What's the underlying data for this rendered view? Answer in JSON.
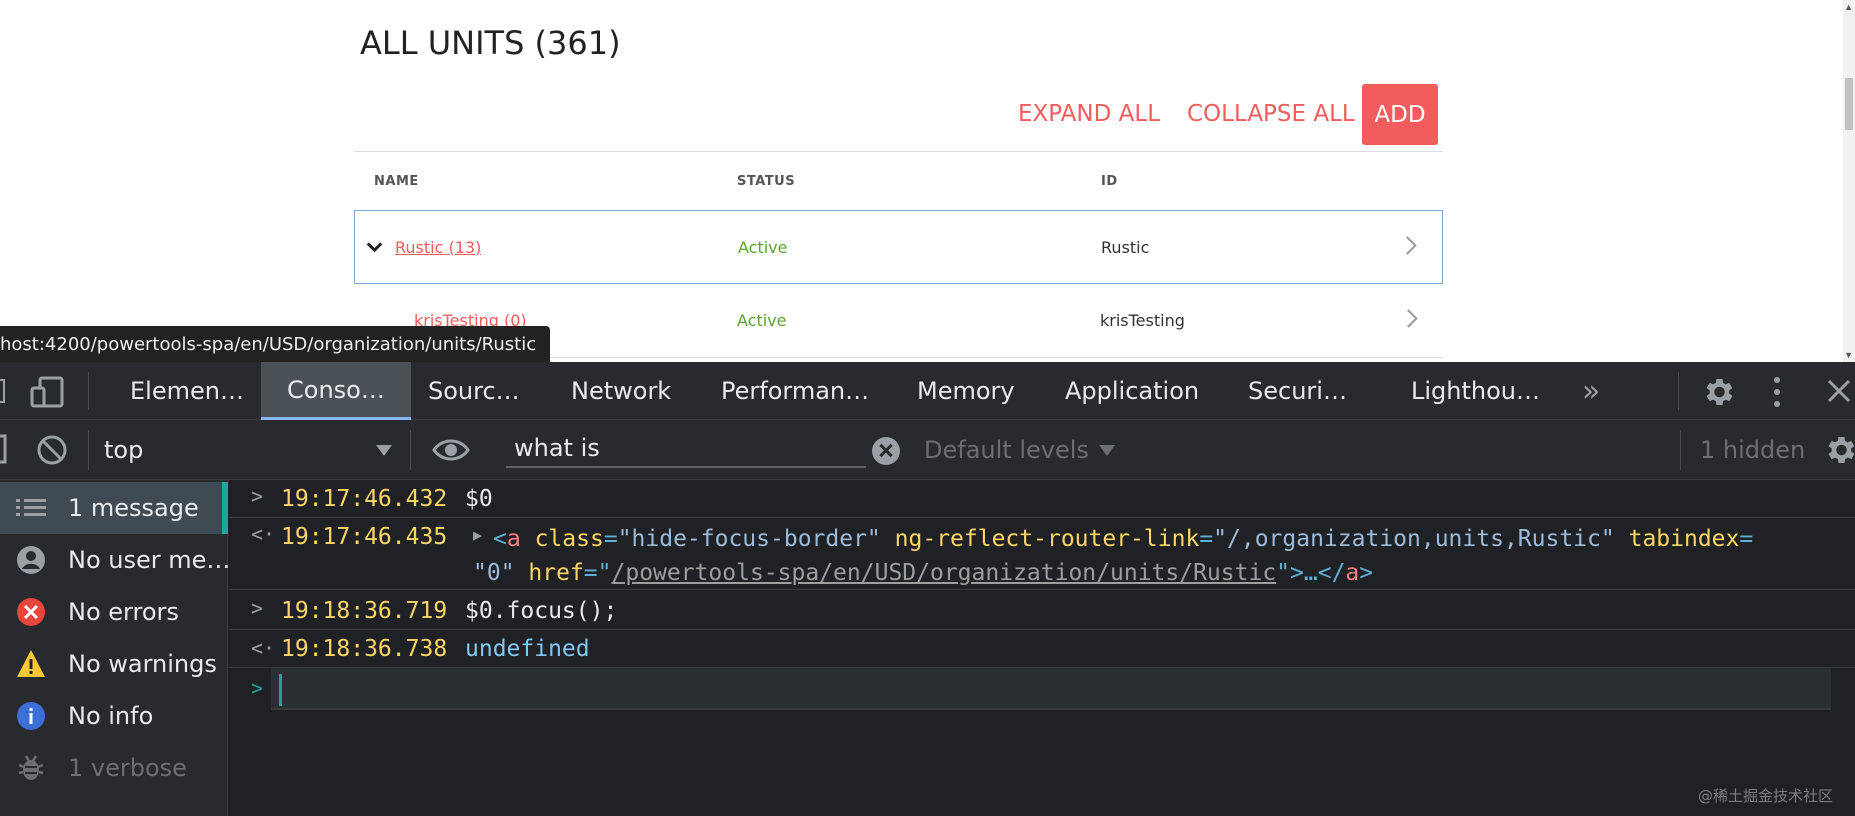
{
  "page": {
    "title": "ALL UNITS (361)",
    "actions": {
      "expand_all": "EXPAND ALL",
      "collapse_all": "COLLAPSE ALL",
      "add": "ADD"
    },
    "columns": [
      "NAME",
      "STATUS",
      "ID"
    ],
    "rows": [
      {
        "name": "Rustic (13)",
        "status": "Active",
        "id": "Rustic"
      },
      {
        "name": "krisTesting (0)",
        "status": "Active",
        "id": "krisTesting"
      }
    ],
    "url_tooltip": "host:4200/powertools-spa/en/USD/organization/units/Rustic"
  },
  "devtools": {
    "tabs": [
      "Elemen…",
      "Conso…",
      "Sourc…",
      "Network",
      "Performan…",
      "Memory",
      "Application",
      "Securi…",
      "Lighthou…"
    ],
    "active_tab": "Conso…",
    "context": "top",
    "filter_value": "what is",
    "levels": "Default levels",
    "hidden": "1 hidden",
    "sidebar": [
      {
        "label": "1 message",
        "icon": "list-icon"
      },
      {
        "label": "No user me…",
        "icon": "user-icon"
      },
      {
        "label": "No errors",
        "icon": "error-icon"
      },
      {
        "label": "No warnings",
        "icon": "warning-icon"
      },
      {
        "label": "No info",
        "icon": "info-icon"
      },
      {
        "label": "1 verbose",
        "icon": "bug-icon"
      }
    ],
    "messages": [
      {
        "type": "input",
        "time": "19:17:46.432",
        "text": "$0"
      },
      {
        "type": "output",
        "time": "19:17:46.435",
        "html_line1_a": "<",
        "html_tag": "a",
        "html_attr1_name": "class",
        "html_attr1_val": "\"hide-focus-border\"",
        "html_attr2_name": "ng-reflect-router-link",
        "html_attr2_val": "\"/,organization,units,Rustic\"",
        "html_attr3_name": "tabindex",
        "html_line2_val": "\"0\"",
        "html_attr4_name": "href",
        "html_url": "/powertools-spa/en/USD/organization/units/Rustic",
        "html_close": ">…</",
        "html_end": ">"
      },
      {
        "type": "input",
        "time": "19:18:36.719",
        "text": "$0.focus();"
      },
      {
        "type": "output",
        "time": "19:18:36.738",
        "text": "undefined"
      }
    ]
  },
  "watermark": "@稀土掘金技术社区",
  "colors": {
    "accent": "#f25c5c",
    "active_status": "#5aa332",
    "devtools_bg": "#202124",
    "teal": "#1ea59b",
    "timestamp": "#fdd663"
  }
}
